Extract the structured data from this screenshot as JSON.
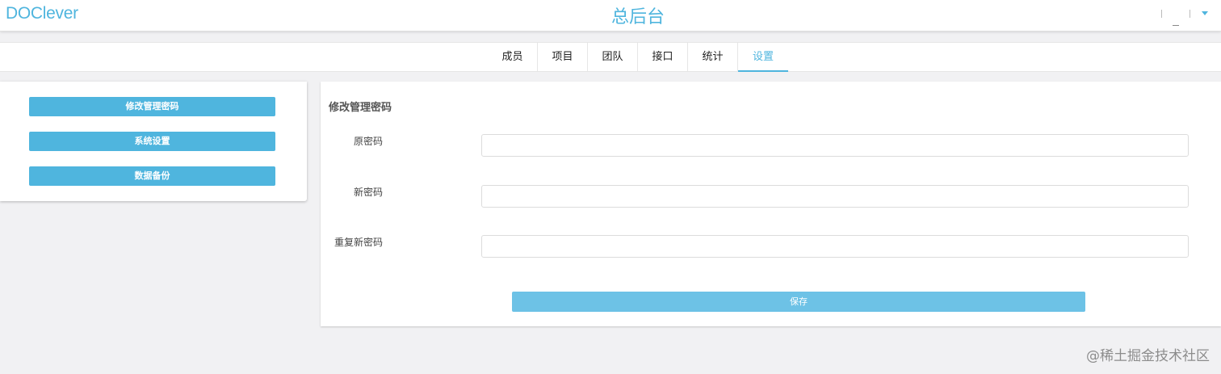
{
  "header": {
    "brand": "DOClever",
    "title": "总后台"
  },
  "tabs": [
    {
      "label": "成员"
    },
    {
      "label": "项目"
    },
    {
      "label": "团队"
    },
    {
      "label": "接口"
    },
    {
      "label": "统计"
    },
    {
      "label": "设置",
      "active": true
    }
  ],
  "sidebar": {
    "buttons": [
      {
        "label": "修改管理密码"
      },
      {
        "label": "系统设置"
      },
      {
        "label": "数据备份"
      }
    ]
  },
  "form": {
    "title": "修改管理密码",
    "fields": [
      {
        "label": "原密码",
        "value": ""
      },
      {
        "label": "新密码",
        "value": ""
      },
      {
        "label": "重复新密码",
        "value": ""
      }
    ],
    "save_label": "保存"
  },
  "watermark": "@稀土掘金技术社区",
  "colors": {
    "accent": "#4fb5de",
    "save_button": "#6dc2e6",
    "background": "#f1f1f3"
  }
}
